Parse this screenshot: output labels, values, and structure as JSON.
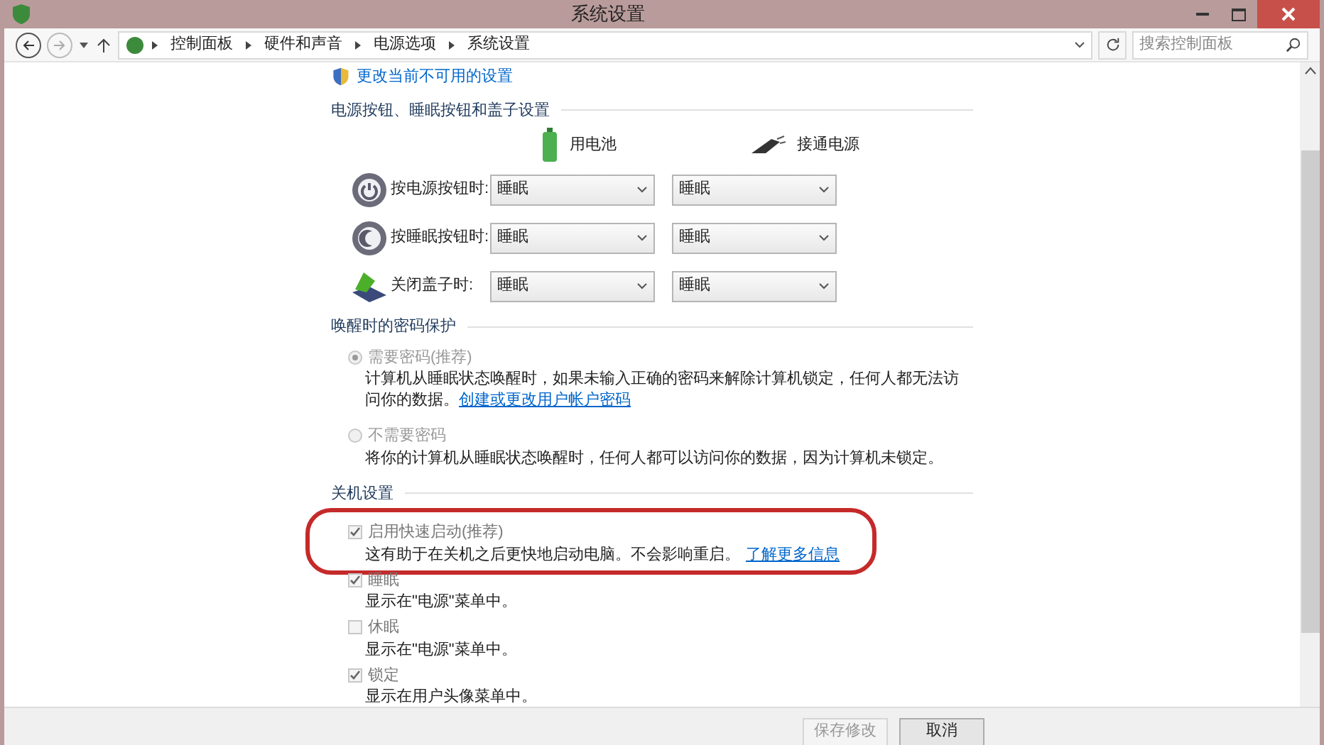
{
  "window": {
    "title": "系统设置"
  },
  "address_bar": {
    "breadcrumbs": [
      "控制面板",
      "硬件和声音",
      "电源选项",
      "系统设置"
    ],
    "search_placeholder": "搜索控制面板"
  },
  "change_settings_link": "更改当前不可用的设置",
  "buttons_section": {
    "title": "电源按钮、睡眠按钮和盖子设置",
    "columns": [
      "用电池",
      "接通电源"
    ],
    "rows": [
      {
        "kind": "power",
        "label": "按电源按钮时:",
        "battery": "睡眠",
        "plugged": "睡眠"
      },
      {
        "kind": "sleep",
        "label": "按睡眠按钮时:",
        "battery": "睡眠",
        "plugged": "睡眠"
      },
      {
        "kind": "lid",
        "label": "关闭盖子时:",
        "battery": "睡眠",
        "plugged": "睡眠"
      }
    ]
  },
  "password_section": {
    "title": "唤醒时的密码保护",
    "options": [
      {
        "label": "需要密码(推荐)",
        "selected": true,
        "description": "计算机从睡眠状态唤醒时，如果未输入正确的密码来解除计算机锁定，任何人都无法访问你的数据。",
        "link": "创建或更改用户帐户密码"
      },
      {
        "label": "不需要密码",
        "selected": false,
        "description": "将你的计算机从睡眠状态唤醒时，任何人都可以访问你的数据，因为计算机未锁定。"
      }
    ]
  },
  "shutdown_section": {
    "title": "关机设置",
    "items": [
      {
        "label": "启用快速启动(推荐)",
        "checked": true,
        "highlighted": true,
        "description": "这有助于在关机之后更快地启动电脑。不会影响重启。",
        "link": "了解更多信息"
      },
      {
        "label": "睡眠",
        "checked": true,
        "highlighted": false,
        "description": "显示在\"电源\"菜单中。"
      },
      {
        "label": "休眠",
        "checked": false,
        "highlighted": false,
        "description": "显示在\"电源\"菜单中。"
      },
      {
        "label": "锁定",
        "checked": true,
        "highlighted": false,
        "description": "显示在用户头像菜单中。"
      }
    ]
  },
  "footer_buttons": [
    {
      "label": "保存修改",
      "disabled": true
    },
    {
      "label": "取消",
      "disabled": false
    }
  ]
}
